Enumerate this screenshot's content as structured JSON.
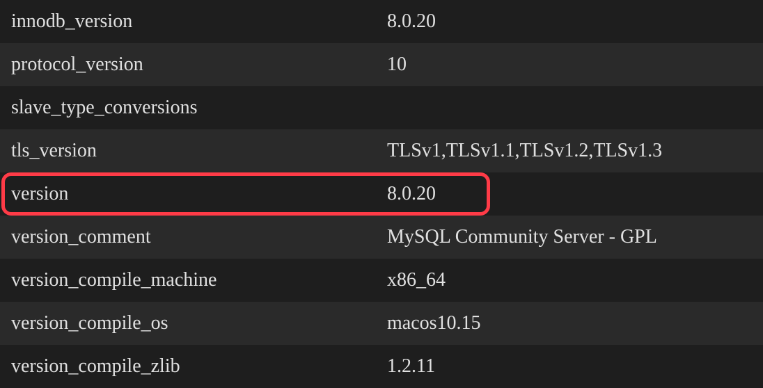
{
  "variables": [
    {
      "name": "innodb_version",
      "value": "8.0.20",
      "highlighted": false
    },
    {
      "name": "protocol_version",
      "value": "10",
      "highlighted": false
    },
    {
      "name": "slave_type_conversions",
      "value": "",
      "highlighted": false
    },
    {
      "name": "tls_version",
      "value": "TLSv1,TLSv1.1,TLSv1.2,TLSv1.3",
      "highlighted": false
    },
    {
      "name": "version",
      "value": "8.0.20",
      "highlighted": true
    },
    {
      "name": "version_comment",
      "value": "MySQL Community Server - GPL",
      "highlighted": false
    },
    {
      "name": "version_compile_machine",
      "value": "x86_64",
      "highlighted": false
    },
    {
      "name": "version_compile_os",
      "value": "macos10.15",
      "highlighted": false
    },
    {
      "name": "version_compile_zlib",
      "value": "1.2.11",
      "highlighted": false
    }
  ]
}
